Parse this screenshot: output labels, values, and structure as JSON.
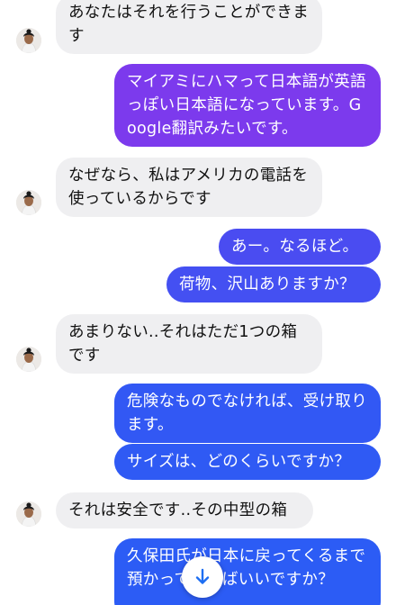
{
  "colors": {
    "incoming_bg": "#efeff1",
    "outgoing_purple": "#7c3aed",
    "outgoing_blue": "#2f55f5",
    "accent_blue": "#1d6ef2"
  },
  "messages": [
    {
      "side": "in",
      "text": "あなたはそれを行うことができます"
    },
    {
      "side": "out",
      "text": "マイアミにハマって日本語が英語っぽい日本語になっています。Google翻訳みたいです。"
    },
    {
      "side": "in",
      "text": "なぜなら、私はアメリカの電話を使っているからです"
    },
    {
      "side": "out",
      "text": "あー。なるほど。"
    },
    {
      "side": "out",
      "text": "荷物、沢山ありますか？"
    },
    {
      "side": "in",
      "text": "あまりない..それはただ1つの箱です"
    },
    {
      "side": "out",
      "text": "危険なものでなければ、受け取ります。"
    },
    {
      "side": "out",
      "text": "サイズは、どのくらいですか？"
    },
    {
      "side": "in",
      "text": "それは安全です..その中型の箱"
    },
    {
      "side": "out",
      "text": "久保田氏が日本に戻ってくるまで預かっていればいいですか？"
    }
  ],
  "scroll_button": {
    "icon": "arrow-down-icon"
  }
}
